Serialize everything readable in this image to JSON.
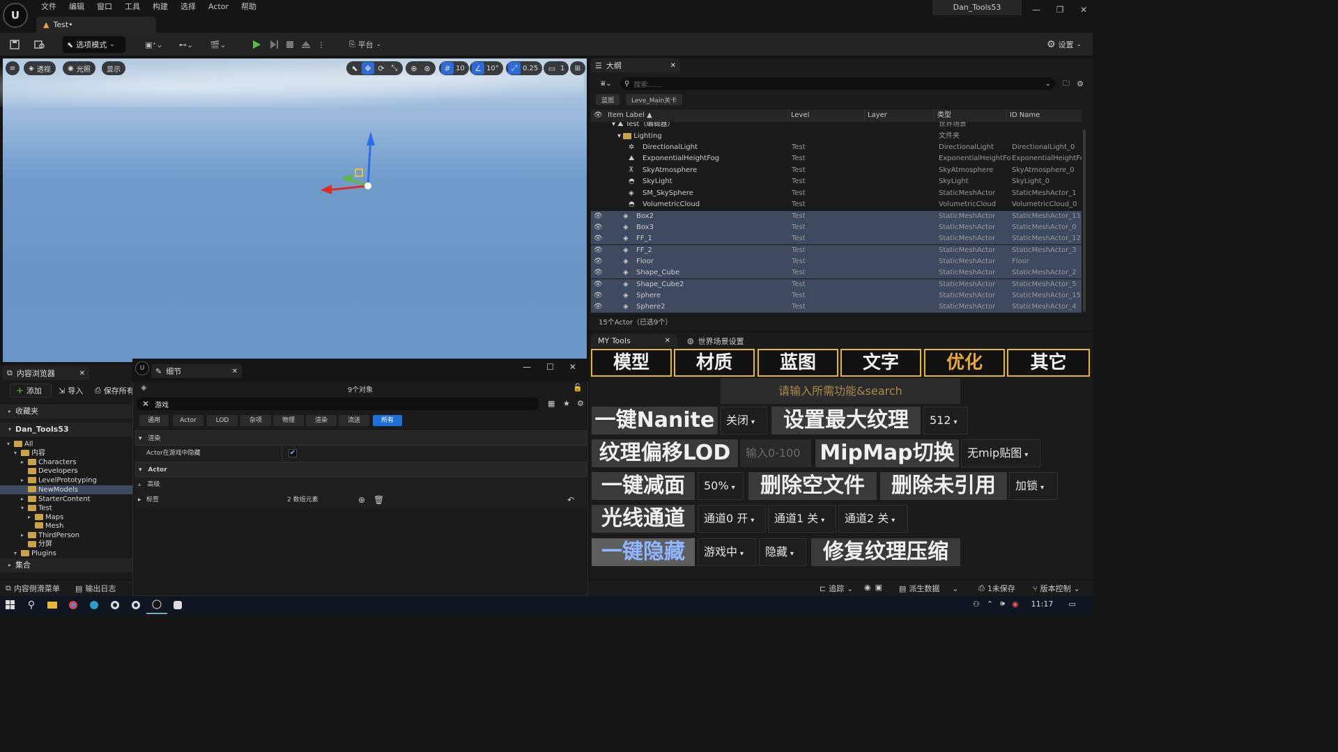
{
  "app": {
    "logo": "U",
    "menu": [
      "文件",
      "编辑",
      "窗口",
      "工具",
      "构建",
      "选择",
      "Actor",
      "帮助"
    ],
    "doc_tab": "Test•",
    "project_title": "Dan_Tools53",
    "win_controls": [
      "—",
      "❐",
      "✕"
    ]
  },
  "toolbar": {
    "mode": "选项模式",
    "platform": "平台",
    "settings": "设置"
  },
  "viewport": {
    "view_buttons": [
      "透视",
      "光照",
      "显示"
    ],
    "grid_snap": "10",
    "rotate_snap": "10°",
    "scale_snap": "0.25",
    "camera_speed": "1"
  },
  "outliner": {
    "tab": "大纲",
    "search_placeholder": "搜索……",
    "filter_chips": [
      "蓝图",
      "Leve_Main关卡"
    ],
    "columns": [
      "Item Label ▲",
      "Level",
      "Layer",
      "类型",
      "ID Name"
    ],
    "world_row": {
      "name": "Test（编辑器）",
      "type": "世界场景"
    },
    "lighting_folder": {
      "name": "Lighting",
      "type": "文件夹"
    },
    "lighting_items": [
      {
        "name": "DirectionalLight",
        "level": "Test",
        "type": "DirectionalLight",
        "id": "DirectionalLight_0"
      },
      {
        "name": "ExponentialHeightFog",
        "level": "Test",
        "type": "ExponentialHeightFog",
        "id": "ExponentialHeightFog"
      },
      {
        "name": "SkyAtmosphere",
        "level": "Test",
        "type": "SkyAtmosphere",
        "id": "SkyAtmosphere_0"
      },
      {
        "name": "SkyLight",
        "level": "Test",
        "type": "SkyLight",
        "id": "SkyLight_0"
      },
      {
        "name": "SM_SkySphere",
        "level": "Test",
        "type": "StaticMeshActor",
        "id": "StaticMeshActor_1"
      },
      {
        "name": "VolumetricCloud",
        "level": "Test",
        "type": "VolumetricCloud",
        "id": "VolumetricCloud_0"
      }
    ],
    "actors": [
      {
        "name": "Box2",
        "level": "Test",
        "type": "StaticMeshActor",
        "id": "StaticMeshActor_11"
      },
      {
        "name": "Box3",
        "level": "Test",
        "type": "StaticMeshActor",
        "id": "StaticMeshActor_0"
      },
      {
        "name": "FF_1",
        "level": "Test",
        "type": "StaticMeshActor",
        "id": "StaticMeshActor_12"
      },
      {
        "name": "FF_2",
        "level": "Test",
        "type": "StaticMeshActor",
        "id": "StaticMeshActor_3"
      },
      {
        "name": "Floor",
        "level": "Test",
        "type": "StaticMeshActor",
        "id": "Floor"
      },
      {
        "name": "Shape_Cube",
        "level": "Test",
        "type": "StaticMeshActor",
        "id": "StaticMeshActor_2"
      },
      {
        "name": "Shape_Cube2",
        "level": "Test",
        "type": "StaticMeshActor",
        "id": "StaticMeshActor_5"
      },
      {
        "name": "Sphere",
        "level": "Test",
        "type": "StaticMeshActor",
        "id": "StaticMeshActor_15"
      },
      {
        "name": "Sphere2",
        "level": "Test",
        "type": "StaticMeshActor",
        "id": "StaticMeshActor_4"
      }
    ],
    "status": "15个Actor（已选9个）"
  },
  "mytools": {
    "tab": "MY Tools",
    "world_tab": "世界场景设置",
    "categories": [
      "模型",
      "材质",
      "蓝图",
      "文字",
      "优化",
      "其它"
    ],
    "active_category": "优化",
    "search_placeholder": "请输入所需功能&search",
    "nanite": {
      "label": "一键Nanite",
      "option": "关闭"
    },
    "max_texture": {
      "label": "设置最大纹理",
      "option": "512"
    },
    "lod_offset": {
      "label": "纹理偏移LOD",
      "placeholder": "输入0-100"
    },
    "mipmap": {
      "label": "MipMap切换",
      "option": "无mip贴图"
    },
    "reduce": {
      "label": "一键减面",
      "option": "50%"
    },
    "del_empty": {
      "label": "删除空文件"
    },
    "del_unref": {
      "label": "删除未引用"
    },
    "lock": {
      "option": "加锁"
    },
    "light_channel": {
      "label": "光线通道",
      "ch0": "通道0 开",
      "ch1": "通道1 关",
      "ch2": "通道2 关"
    },
    "hide": {
      "label": "一键隐藏",
      "opt1": "游戏中",
      "opt2": "隐藏"
    },
    "fix_compress": {
      "label": "修复纹理压缩"
    }
  },
  "content_browser": {
    "tab": "内容浏览器",
    "add": "添加",
    "import": "导入",
    "save_all": "保存所有",
    "favorites": "收藏夹",
    "project": "Dan_Tools53",
    "tree": [
      {
        "label": "All",
        "depth": 0,
        "open": true
      },
      {
        "label": "内容",
        "depth": 1,
        "open": true
      },
      {
        "label": "Characters",
        "depth": 2,
        "open": false
      },
      {
        "label": "Developers",
        "depth": 2,
        "open": null
      },
      {
        "label": "LevelPrototyping",
        "depth": 2,
        "open": false
      },
      {
        "label": "NewModels",
        "depth": 2,
        "open": null,
        "selected": true
      },
      {
        "label": "StarterContent",
        "depth": 2,
        "open": false
      },
      {
        "label": "Test",
        "depth": 2,
        "open": true
      },
      {
        "label": "Maps",
        "depth": 3,
        "open": false
      },
      {
        "label": "Mesh",
        "depth": 3,
        "open": null
      },
      {
        "label": "ThirdPerson",
        "depth": 2,
        "open": false
      },
      {
        "label": "分屏",
        "depth": 2,
        "open": null
      },
      {
        "label": "Plugins",
        "depth": 1,
        "open": true
      }
    ],
    "collections": "集合"
  },
  "details": {
    "tab": "细节",
    "object_count": "9个对象",
    "search_value": "游戏",
    "filters": [
      "通用",
      "Actor",
      "LOD",
      "杂项",
      "物理",
      "渲染",
      "流送",
      "所有"
    ],
    "active_filter": "所有",
    "section_render": "渲染",
    "hidden_in_game_label": "Actor在游戏中隐藏",
    "hidden_in_game": true,
    "section_actor": "Actor",
    "advanced": "高级",
    "tags_label": "标签",
    "tags_value": "2 数组元素"
  },
  "bottom_left": {
    "drawer": "内容侧滑菜单",
    "output_log": "输出日志"
  },
  "bottom_right": {
    "trace": "追踪",
    "derived_data": "派生数据",
    "unsaved": "1未保存",
    "source_control": "版本控制"
  },
  "taskbar": {
    "time": "11:17"
  },
  "colors": {
    "accent": "#1f6fd8",
    "category_border": "#e6b832",
    "selected_row": "#3e4a5f",
    "highlight_text": "#e8a838"
  }
}
